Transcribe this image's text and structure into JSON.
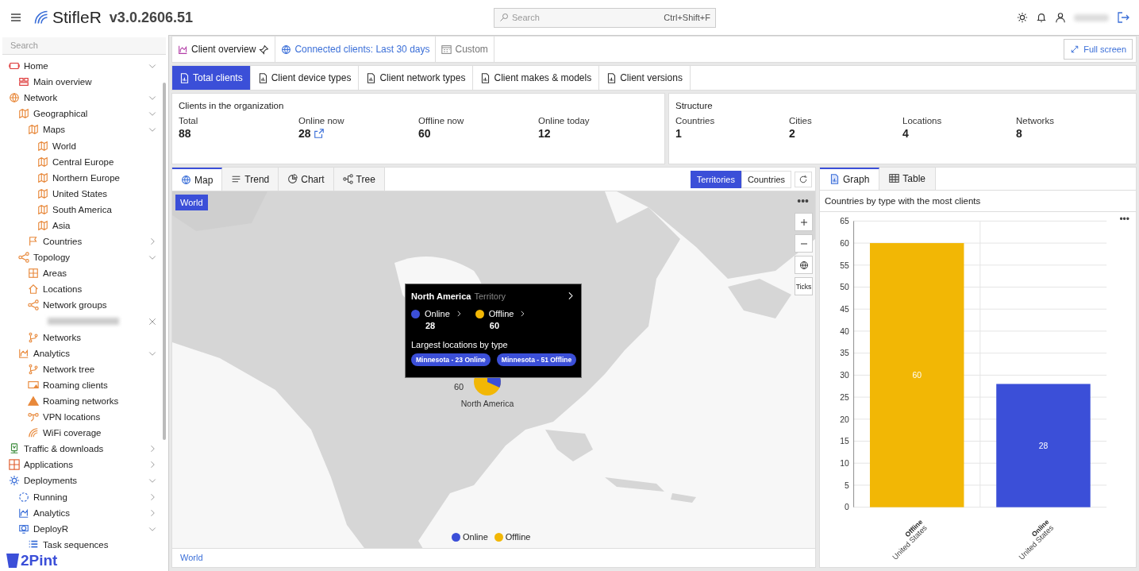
{
  "header": {
    "app_name": "StifleR",
    "version": "v3.0.2606.51",
    "search": {
      "placeholder": "Search",
      "shortcut": "Ctrl+Shift+F"
    }
  },
  "sidebar": {
    "search": {
      "placeholder": "Search"
    },
    "brand": "2Pint",
    "items": [
      {
        "label": "Home",
        "expanded": true,
        "children": [
          {
            "label": "Main overview"
          }
        ]
      },
      {
        "label": "Network",
        "expanded": true,
        "children": [
          {
            "label": "Geographical",
            "expanded": true,
            "children": [
              {
                "label": "Maps",
                "expanded": true,
                "children": [
                  {
                    "label": "World"
                  },
                  {
                    "label": "Central Europe"
                  },
                  {
                    "label": "Northern Europe"
                  },
                  {
                    "label": "United States"
                  },
                  {
                    "label": "South America"
                  },
                  {
                    "label": "Asia"
                  }
                ]
              },
              {
                "label": "Countries",
                "expanded": false
              }
            ]
          },
          {
            "label": "Topology",
            "expanded": true,
            "children": [
              {
                "label": "Areas"
              },
              {
                "label": "Locations"
              },
              {
                "label": "Network groups",
                "children": [
                  {
                    "kind": "redacted"
                  }
                ]
              },
              {
                "label": "Networks"
              }
            ]
          },
          {
            "label": "Analytics",
            "expanded": true,
            "children": [
              {
                "label": "Network tree"
              },
              {
                "label": "Roaming clients"
              },
              {
                "label": "Roaming networks"
              },
              {
                "label": "VPN locations"
              },
              {
                "label": "WiFi coverage"
              }
            ]
          }
        ]
      },
      {
        "label": "Traffic & downloads",
        "expanded": false
      },
      {
        "label": "Applications",
        "expanded": false
      },
      {
        "label": "Deployments",
        "expanded": true,
        "children": [
          {
            "label": "Running",
            "expanded": false
          },
          {
            "label": "Analytics",
            "expanded": false
          },
          {
            "label": "DeployR",
            "expanded": true,
            "children": [
              {
                "label": "Task sequences"
              }
            ]
          }
        ]
      }
    ]
  },
  "toolbar": {
    "title": "Client overview",
    "period": "Connected clients: Last 30 days",
    "custom": "Custom",
    "full_screen": "Full screen"
  },
  "tabs": [
    {
      "label": "Total clients",
      "selected": true
    },
    {
      "label": "Client device types",
      "selected": false
    },
    {
      "label": "Client network types",
      "selected": false
    },
    {
      "label": "Client makes & models",
      "selected": false
    },
    {
      "label": "Client versions",
      "selected": false
    }
  ],
  "cards": [
    {
      "title": "Clients in the organization",
      "stats": [
        {
          "label": "Total",
          "value": "88"
        },
        {
          "label": "Online now",
          "value": "28",
          "link": true
        },
        {
          "label": "Offline now",
          "value": "60"
        },
        {
          "label": "Online today",
          "value": "12"
        }
      ]
    },
    {
      "title": "Structure",
      "stats": [
        {
          "label": "Countries",
          "value": "1"
        },
        {
          "label": "Cities",
          "value": "2"
        },
        {
          "label": "Locations",
          "value": "4"
        },
        {
          "label": "Networks",
          "value": "8"
        }
      ]
    }
  ],
  "map_panel": {
    "tabs": [
      {
        "label": "Map",
        "selected": true
      },
      {
        "label": "Trend",
        "selected": false
      },
      {
        "label": "Chart",
        "selected": false
      },
      {
        "label": "Tree",
        "selected": false
      }
    ],
    "modes": [
      {
        "label": "Territories",
        "selected": true
      },
      {
        "label": "Countries",
        "selected": false
      }
    ],
    "breadcrumb": "World",
    "ticks": "Ticks",
    "more": "•••",
    "marker": {
      "name": "North America",
      "label": "60"
    },
    "tooltip": {
      "title": "North America",
      "subtitle": "Territory",
      "stats": [
        {
          "label": "Online",
          "value": "28",
          "color": "#3b4fd8"
        },
        {
          "label": "Offline",
          "value": "60",
          "color": "#f2b705"
        }
      ],
      "section": "Largest locations by type",
      "chips": [
        "Minnesota - 23 Online",
        "Minnesota - 51 Offline"
      ]
    },
    "legend": [
      {
        "label": "Online",
        "color": "#3b4fd8"
      },
      {
        "label": "Offline",
        "color": "#f2b705"
      }
    ],
    "footer": "World"
  },
  "graph_panel": {
    "tabs": [
      {
        "label": "Graph",
        "selected": true
      },
      {
        "label": "Table",
        "selected": false
      }
    ],
    "subtitle": "Countries by type with the most clients",
    "more": "•••",
    "chart_data": {
      "type": "bar",
      "grid": true,
      "categories": [
        "United States",
        "United States"
      ],
      "stacked": true,
      "data_labels": true,
      "ylim": [
        0,
        65
      ],
      "yticks": [
        0,
        5,
        10,
        15,
        20,
        25,
        30,
        35,
        40,
        45,
        50,
        55,
        60,
        65
      ],
      "series": [
        {
          "name": "Offline",
          "color": "#f2b705",
          "values": [
            60,
            null
          ]
        },
        {
          "name": "Online",
          "color": "#3b4fd8",
          "values": [
            null,
            28
          ]
        }
      ]
    }
  }
}
